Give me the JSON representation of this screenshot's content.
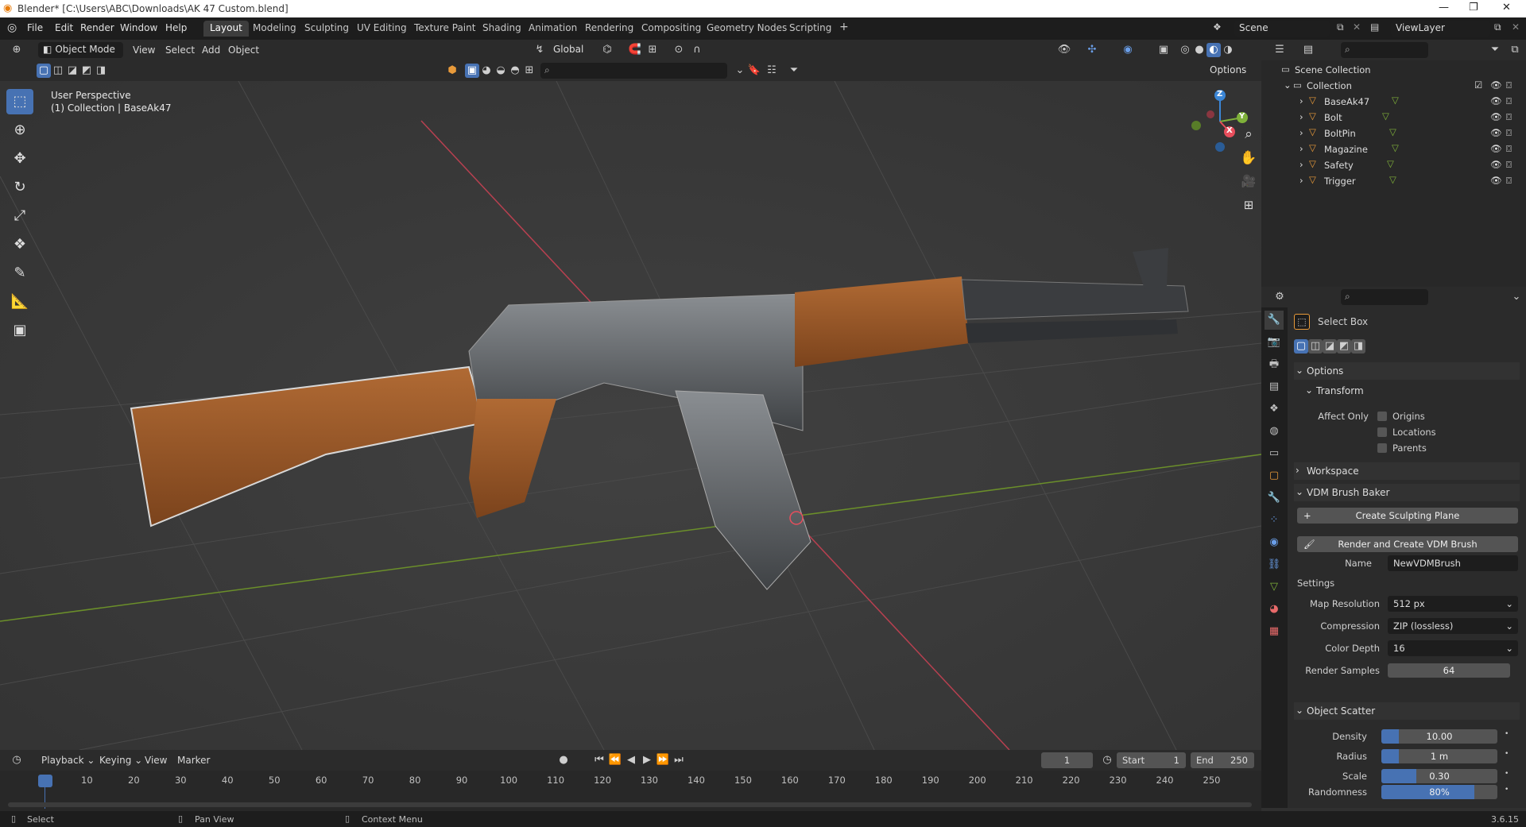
{
  "window": {
    "title": "Blender* [C:\\Users\\ABC\\Downloads\\AK 47 Custom.blend]"
  },
  "menus": [
    "File",
    "Edit",
    "Render",
    "Window",
    "Help"
  ],
  "workspaces": [
    "Layout",
    "Modeling",
    "Sculpting",
    "UV Editing",
    "Texture Paint",
    "Shading",
    "Animation",
    "Rendering",
    "Compositing",
    "Geometry Nodes",
    "Scripting"
  ],
  "active_workspace": "Layout",
  "scene": {
    "scene_name": "Scene",
    "view_layer": "ViewLayer"
  },
  "viewport_header": {
    "mode": "Object Mode",
    "view": "View",
    "select": "Select",
    "add": "Add",
    "object": "Object",
    "orientation": "Global",
    "options": "Options"
  },
  "viewport_overlay": {
    "perspective": "User Perspective",
    "collection": "(1) Collection | BaseAk47"
  },
  "gizmo": {
    "x": "X",
    "y": "Y",
    "z": "Z"
  },
  "outliner": {
    "scene_collection": "Scene Collection",
    "collection": "Collection",
    "objects": [
      "BaseAk47",
      "Bolt",
      "BoltPin",
      "Magazine",
      "Safety",
      "Trigger"
    ]
  },
  "properties": {
    "active_tool": "Select Box",
    "options_label": "Options",
    "transform_label": "Transform",
    "affect_only_label": "Affect Only",
    "affect_only": [
      "Origins",
      "Locations",
      "Parents"
    ],
    "workspace_label": "Workspace",
    "vdm_label": "VDM Brush Baker",
    "create_plane": "Create Sculpting Plane",
    "render_create": "Render and Create VDM Brush",
    "name_label": "Name",
    "name_value": "NewVDMBrush",
    "settings_label": "Settings",
    "map_resolution_label": "Map Resolution",
    "map_resolution": "512 px",
    "compression_label": "Compression",
    "compression": "ZIP (lossless)",
    "color_depth_label": "Color Depth",
    "color_depth": "16",
    "render_samples_label": "Render Samples",
    "render_samples": "64",
    "object_scatter_label": "Object Scatter",
    "density_label": "Density",
    "density": "10.00",
    "density_fill": 0.15,
    "radius_label": "Radius",
    "radius": "1 m",
    "radius_fill": 0.15,
    "scale_label": "Scale",
    "scale": "0.30",
    "scale_fill": 0.3,
    "randomness_label": "Randomness",
    "randomness": "80%",
    "randomness_fill": 0.8
  },
  "timeline": {
    "menus": [
      "Playback",
      "Keying",
      "View",
      "Marker"
    ],
    "current_frame": "1",
    "start_label": "Start",
    "start": "1",
    "end_label": "End",
    "end": "250",
    "ticks": [
      "1",
      "10",
      "20",
      "30",
      "40",
      "50",
      "60",
      "70",
      "80",
      "90",
      "100",
      "110",
      "120",
      "130",
      "140",
      "150",
      "160",
      "170",
      "180",
      "190",
      "200",
      "210",
      "220",
      "230",
      "240",
      "250"
    ]
  },
  "statusbar": {
    "select": "Select",
    "pan_view": "Pan View",
    "context_menu": "Context Menu",
    "version": "3.6.15"
  },
  "colors": {
    "accent": "#4772b3",
    "x_axis": "#e84e5c",
    "y_axis": "#7fb13a",
    "z_axis": "#3b86d6",
    "wood": "#9a5a2a",
    "metal": "#5d6266"
  }
}
